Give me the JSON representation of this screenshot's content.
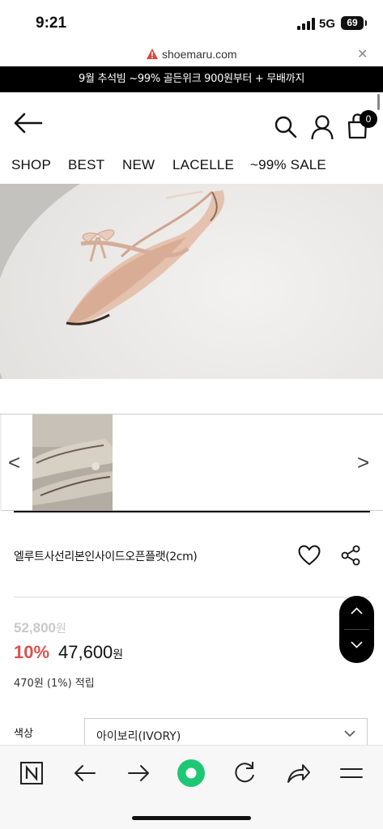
{
  "status": {
    "time": "9:21",
    "network": "5G",
    "battery": "69"
  },
  "browser": {
    "url": "shoemaru.com",
    "close_icon": "close-icon"
  },
  "promo": {
    "text": "9월 추석빔 ~99% 골든위크 900원부터 + 무배까지"
  },
  "header": {
    "cart_count": "0"
  },
  "nav": {
    "items": [
      "SHOP",
      "BEST",
      "NEW",
      "LACELLE",
      "~99% SALE"
    ]
  },
  "gallery": {
    "prev": "<",
    "next": ">"
  },
  "product": {
    "name": "엘루트사선리본인사이드오픈플랫(2cm)",
    "original_price": "52,800",
    "original_unit": "원",
    "discount": "10%",
    "price": "47,600",
    "price_unit": "원",
    "points": "470원 (1%) 적립"
  },
  "options": {
    "color_label": "색상",
    "color_value": "아이보리(IVORY)"
  },
  "colors": {
    "promo_bg": "#000000",
    "discount": "#d9534f",
    "original_price": "#c9c9c9",
    "accent_green": "#1ec773"
  }
}
